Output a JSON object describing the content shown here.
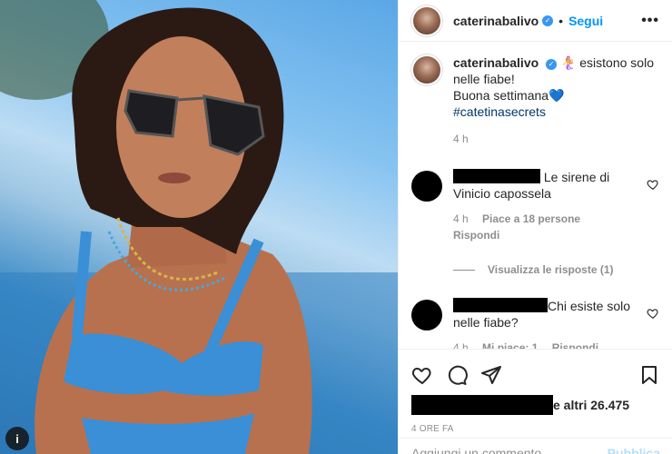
{
  "post": {
    "username": "caterinabalivo",
    "follow_label": "Segui",
    "more_label": "•••",
    "multi_indicator": "i"
  },
  "caption": {
    "username": "caterinabalivo",
    "line1": "🧜‍♀️ esistono solo nelle fiabe!",
    "line2": "Buona settimana",
    "heart": "💙",
    "hashtag": "#catetinasecrets",
    "time": "4 h"
  },
  "comments": [
    {
      "text": "Le sirene di Vinicio capossela",
      "time": "4 h",
      "likes": "Piace a 18 persone",
      "reply": "Rispondi",
      "view_replies": "Visualizza le risposte (1)"
    },
    {
      "text": "Chi esiste solo nelle fiabe?",
      "time": "4 h",
      "likes": "Mi piace: 1",
      "reply": "Rispondi"
    }
  ],
  "likes_text": "e altri 26.475",
  "timestamp": "4 ORE FA",
  "add_comment": {
    "placeholder": "Aggiungi un commento...",
    "publish": "Pubblica"
  },
  "colors": {
    "accent": "#0095f6",
    "verified": "#3897f0",
    "muted": "#8e8e8e"
  }
}
